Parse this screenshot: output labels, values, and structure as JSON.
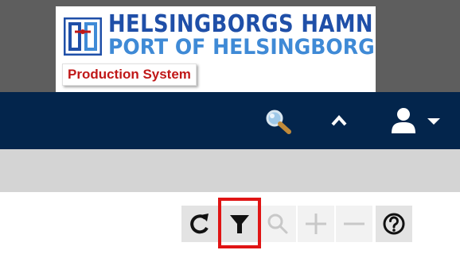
{
  "header": {
    "logo_title": "HELSINGBORGS HAMN",
    "logo_subtitle": "PORT OF HELSINGBORG",
    "system_badge": "Production System"
  },
  "nav": {
    "icons": [
      "search-icon",
      "chevron-up-icon",
      "user-icon",
      "caret-down-icon"
    ]
  },
  "toolbar": {
    "buttons": [
      {
        "name": "refresh",
        "icon": "refresh-icon",
        "enabled": true
      },
      {
        "name": "filter",
        "icon": "filter-icon",
        "enabled": true,
        "highlighted": true
      },
      {
        "name": "search",
        "icon": "search-icon",
        "enabled": false
      },
      {
        "name": "add",
        "icon": "plus-icon",
        "enabled": false
      },
      {
        "name": "remove",
        "icon": "minus-icon",
        "enabled": false
      },
      {
        "name": "help",
        "icon": "help-icon",
        "enabled": true
      }
    ]
  },
  "colors": {
    "nav_bar": "#03254c",
    "header_band": "#5e5e5e",
    "grey_strip": "#d4d4d4",
    "logo_title": "#1f4fa8",
    "logo_subtitle": "#3f8ad6",
    "badge_text": "#c01818",
    "highlight": "#e01414"
  }
}
